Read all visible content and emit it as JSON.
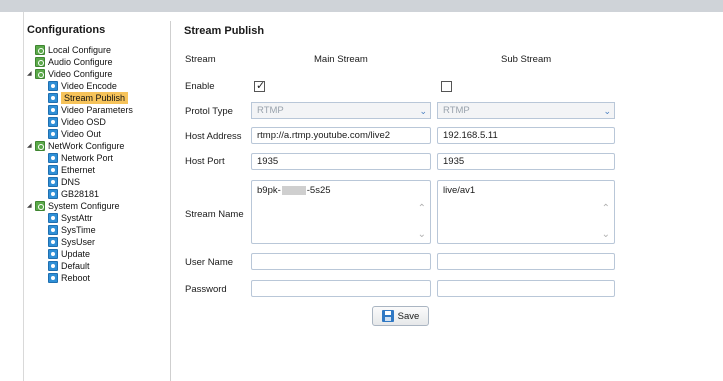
{
  "sidebar": {
    "title": "Configurations",
    "items": [
      {
        "label": "Local Configure",
        "kind": "folder",
        "level": 0
      },
      {
        "label": "Audio Configure",
        "kind": "folder",
        "level": 0
      },
      {
        "label": "Video Configure",
        "kind": "folder",
        "level": 0,
        "expanded": true
      },
      {
        "label": "Video Encode",
        "kind": "leaf",
        "level": 1
      },
      {
        "label": "Stream Publish",
        "kind": "leaf",
        "level": 1,
        "selected": true
      },
      {
        "label": "Video Parameters",
        "kind": "leaf",
        "level": 1
      },
      {
        "label": "Video OSD",
        "kind": "leaf",
        "level": 1
      },
      {
        "label": "Video Out",
        "kind": "leaf",
        "level": 1
      },
      {
        "label": "NetWork Configure",
        "kind": "folder",
        "level": 0,
        "expanded": true
      },
      {
        "label": "Network Port",
        "kind": "leaf",
        "level": 1
      },
      {
        "label": "Ethernet",
        "kind": "leaf",
        "level": 1
      },
      {
        "label": "DNS",
        "kind": "leaf",
        "level": 1
      },
      {
        "label": "GB28181",
        "kind": "leaf",
        "level": 1
      },
      {
        "label": "System Configure",
        "kind": "folder",
        "level": 0,
        "expanded": true
      },
      {
        "label": "SystAttr",
        "kind": "leaf",
        "level": 1
      },
      {
        "label": "SysTime",
        "kind": "leaf",
        "level": 1
      },
      {
        "label": "SysUser",
        "kind": "leaf",
        "level": 1
      },
      {
        "label": "Update",
        "kind": "leaf",
        "level": 1
      },
      {
        "label": "Default",
        "kind": "leaf",
        "level": 1
      },
      {
        "label": "Reboot",
        "kind": "leaf",
        "level": 1
      }
    ]
  },
  "main": {
    "title": "Stream Publish",
    "labels": {
      "stream": "Stream",
      "enable": "Enable",
      "protocol_type": "Protol Type",
      "host_address": "Host Address",
      "host_port": "Host Port",
      "stream_name": "Stream Name",
      "user_name": "User Name",
      "password": "Password"
    },
    "main_stream": {
      "heading": "Main Stream",
      "enabled": true,
      "protocol": "RTMP",
      "host_address": "rtmp://a.rtmp.youtube.com/live2",
      "host_port": "1935",
      "stream_name_prefix": "b9pk-",
      "stream_name_suffix": "-5s25",
      "user_name": "",
      "password": ""
    },
    "sub_stream": {
      "heading": "Sub Stream",
      "enabled": false,
      "protocol": "RTMP",
      "host_address": "192.168.5.11",
      "host_port": "1935",
      "stream_name": "live/av1",
      "user_name": "",
      "password": ""
    },
    "save_label": "Save"
  },
  "icons": {
    "checkmark": "✓",
    "dropdown": "chevron-down-icon",
    "save": "save-disk-icon",
    "folder": "folder-gear-icon",
    "page": "page-icon"
  },
  "colors": {
    "selected_bg": "#f6c35a",
    "folder_green": "#5ba94a",
    "leaf_blue": "#2f8fd6",
    "input_border": "#b9c7d8"
  }
}
